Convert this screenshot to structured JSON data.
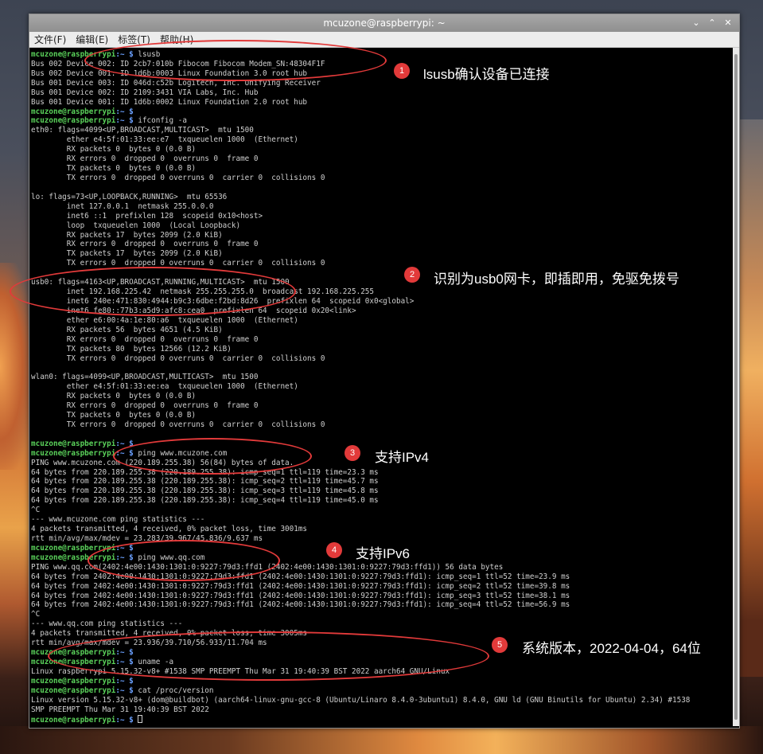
{
  "window": {
    "title": "mcuzone@raspberrypi: ~",
    "buttons": [
      "⌄",
      "⌃",
      "✕"
    ]
  },
  "menu": [
    "文件(F)",
    "编辑(E)",
    "标签(T)",
    "帮助(H)"
  ],
  "prompt_user": "mcuzone@raspberrypi",
  "prompt_path": ":~ $",
  "terminal_lines": [
    {
      "p": true,
      "t": " lsusb"
    },
    {
      "t": "Bus 002 Device 002: ID 2cb7:010b Fibocom Fibocom Modem_SN:48304F1F"
    },
    {
      "t": "Bus 002 Device 001: ID 1d6b:0003 Linux Foundation 3.0 root hub"
    },
    {
      "t": "Bus 001 Device 003: ID 046d:c52b Logitech, Inc. Unifying Receiver"
    },
    {
      "t": "Bus 001 Device 002: ID 2109:3431 VIA Labs, Inc. Hub"
    },
    {
      "t": "Bus 001 Device 001: ID 1d6b:0002 Linux Foundation 2.0 root hub"
    },
    {
      "p": true,
      "t": ""
    },
    {
      "p": true,
      "t": " ifconfig -a"
    },
    {
      "t": "eth0: flags=4099<UP,BROADCAST,MULTICAST>  mtu 1500"
    },
    {
      "t": "        ether e4:5f:01:33:ee:e7  txqueuelen 1000  (Ethernet)"
    },
    {
      "t": "        RX packets 0  bytes 0 (0.0 B)"
    },
    {
      "t": "        RX errors 0  dropped 0  overruns 0  frame 0"
    },
    {
      "t": "        TX packets 0  bytes 0 (0.0 B)"
    },
    {
      "t": "        TX errors 0  dropped 0 overruns 0  carrier 0  collisions 0"
    },
    {
      "t": ""
    },
    {
      "t": "lo: flags=73<UP,LOOPBACK,RUNNING>  mtu 65536"
    },
    {
      "t": "        inet 127.0.0.1  netmask 255.0.0.0"
    },
    {
      "t": "        inet6 ::1  prefixlen 128  scopeid 0x10<host>"
    },
    {
      "t": "        loop  txqueuelen 1000  (Local Loopback)"
    },
    {
      "t": "        RX packets 17  bytes 2099 (2.0 KiB)"
    },
    {
      "t": "        RX errors 0  dropped 0  overruns 0  frame 0"
    },
    {
      "t": "        TX packets 17  bytes 2099 (2.0 KiB)"
    },
    {
      "t": "        TX errors 0  dropped 0 overruns 0  carrier 0  collisions 0"
    },
    {
      "t": ""
    },
    {
      "t": "usb0: flags=4163<UP,BROADCAST,RUNNING,MULTICAST>  mtu 1500"
    },
    {
      "t": "        inet 192.168.225.42  netmask 255.255.255.0  broadcast 192.168.225.255"
    },
    {
      "t": "        inet6 240e:471:830:4944:b9c3:6dbe:f2bd:8d26  prefixlen 64  scopeid 0x0<global>"
    },
    {
      "t": "        inet6 fe80::77b3:a5d9:afc8:cea0  prefixlen 64  scopeid 0x20<link>"
    },
    {
      "t": "        ether e6:00:4a:1e:80:a6  txqueuelen 1000  (Ethernet)"
    },
    {
      "t": "        RX packets 56  bytes 4651 (4.5 KiB)"
    },
    {
      "t": "        RX errors 0  dropped 0  overruns 0  frame 0"
    },
    {
      "t": "        TX packets 80  bytes 12566 (12.2 KiB)"
    },
    {
      "t": "        TX errors 0  dropped 0 overruns 0  carrier 0  collisions 0"
    },
    {
      "t": ""
    },
    {
      "t": "wlan0: flags=4099<UP,BROADCAST,MULTICAST>  mtu 1500"
    },
    {
      "t": "        ether e4:5f:01:33:ee:ea  txqueuelen 1000  (Ethernet)"
    },
    {
      "t": "        RX packets 0  bytes 0 (0.0 B)"
    },
    {
      "t": "        RX errors 0  dropped 0  overruns 0  frame 0"
    },
    {
      "t": "        TX packets 0  bytes 0 (0.0 B)"
    },
    {
      "t": "        TX errors 0  dropped 0 overruns 0  carrier 0  collisions 0"
    },
    {
      "t": ""
    },
    {
      "p": true,
      "t": ""
    },
    {
      "p": true,
      "t": " ping www.mcuzone.com"
    },
    {
      "t": "PING www.mcuzone.com (220.189.255.38) 56(84) bytes of data."
    },
    {
      "t": "64 bytes from 220.189.255.38 (220.189.255.38): icmp_seq=1 ttl=119 time=23.3 ms"
    },
    {
      "t": "64 bytes from 220.189.255.38 (220.189.255.38): icmp_seq=2 ttl=119 time=45.7 ms"
    },
    {
      "t": "64 bytes from 220.189.255.38 (220.189.255.38): icmp_seq=3 ttl=119 time=45.8 ms"
    },
    {
      "t": "64 bytes from 220.189.255.38 (220.189.255.38): icmp_seq=4 ttl=119 time=45.0 ms"
    },
    {
      "t": "^C"
    },
    {
      "t": "--- www.mcuzone.com ping statistics ---"
    },
    {
      "t": "4 packets transmitted, 4 received, 0% packet loss, time 3001ms"
    },
    {
      "t": "rtt min/avg/max/mdev = 23.283/39.967/45.836/9.637 ms"
    },
    {
      "p": true,
      "t": ""
    },
    {
      "p": true,
      "t": " ping www.qq.com"
    },
    {
      "t": "PING www.qq.com(2402:4e00:1430:1301:0:9227:79d3:ffd1 (2402:4e00:1430:1301:0:9227:79d3:ffd1)) 56 data bytes"
    },
    {
      "t": "64 bytes from 2402:4e00:1430:1301:0:9227:79d3:ffd1 (2402:4e00:1430:1301:0:9227:79d3:ffd1): icmp_seq=1 ttl=52 time=23.9 ms"
    },
    {
      "t": "64 bytes from 2402:4e00:1430:1301:0:9227:79d3:ffd1 (2402:4e00:1430:1301:0:9227:79d3:ffd1): icmp_seq=2 ttl=52 time=39.8 ms"
    },
    {
      "t": "64 bytes from 2402:4e00:1430:1301:0:9227:79d3:ffd1 (2402:4e00:1430:1301:0:9227:79d3:ffd1): icmp_seq=3 ttl=52 time=38.1 ms"
    },
    {
      "t": "64 bytes from 2402:4e00:1430:1301:0:9227:79d3:ffd1 (2402:4e00:1430:1301:0:9227:79d3:ffd1): icmp_seq=4 ttl=52 time=56.9 ms"
    },
    {
      "t": "^C"
    },
    {
      "t": "--- www.qq.com ping statistics ---"
    },
    {
      "t": "4 packets transmitted, 4 received, 0% packet loss, time 3005ms"
    },
    {
      "t": "rtt min/avg/max/mdev = 23.936/39.710/56.933/11.704 ms"
    },
    {
      "p": true,
      "t": ""
    },
    {
      "p": true,
      "t": " uname -a"
    },
    {
      "t": "Linux raspberrypi 5.15.32-v8+ #1538 SMP PREEMPT Thu Mar 31 19:40:39 BST 2022 aarch64 GNU/Linux"
    },
    {
      "p": true,
      "t": ""
    },
    {
      "p": true,
      "t": " cat /proc/version"
    },
    {
      "t": "Linux version 5.15.32-v8+ (dom@buildbot) (aarch64-linux-gnu-gcc-8 (Ubuntu/Linaro 8.4.0-3ubuntu1) 8.4.0, GNU ld (GNU Binutils for Ubuntu) 2.34) #1538"
    },
    {
      "t": "SMP PREEMPT Thu Mar 31 19:40:39 BST 2022"
    },
    {
      "p": true,
      "t": " ",
      "cursor": true
    }
  ],
  "annotations": [
    {
      "n": "1",
      "text": "lsusb确认设备已连接"
    },
    {
      "n": "2",
      "text": "识别为usb0网卡，即插即用，免驱免拨号"
    },
    {
      "n": "3",
      "text": "支持IPv4"
    },
    {
      "n": "4",
      "text": "支持IPv6"
    },
    {
      "n": "5",
      "text": "系统版本，2022-04-04，64位"
    }
  ],
  "colors": {
    "accent": "#e23a3a",
    "prompt_user": "#5ad15a",
    "prompt_path": "#6aa0ff"
  }
}
